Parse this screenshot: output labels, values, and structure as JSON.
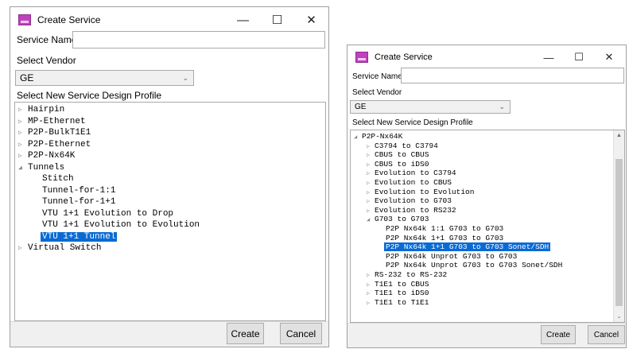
{
  "left_dialog": {
    "title": "Create Service",
    "service_name_label": "Service Name",
    "select_vendor_label": "Select Vendor",
    "vendor_value": "GE",
    "profile_label": "Select New Service Design Profile",
    "tree": [
      {
        "glyph": "▷",
        "label": "Hairpin"
      },
      {
        "glyph": "▷",
        "label": "MP-Ethernet"
      },
      {
        "glyph": "▷",
        "label": "P2P-BulkT1E1"
      },
      {
        "glyph": "▷",
        "label": "P2P-Ethernet"
      },
      {
        "glyph": "▷",
        "label": "P2P-Nx64K"
      },
      {
        "glyph": "◢",
        "label": "Tunnels"
      },
      {
        "glyph": "",
        "label": "Stitch"
      },
      {
        "glyph": "",
        "label": "Tunnel-for-1:1"
      },
      {
        "glyph": "",
        "label": "Tunnel-for-1+1"
      },
      {
        "glyph": "",
        "label": "VTU 1+1 Evolution to Drop"
      },
      {
        "glyph": "",
        "label": "VTU 1+1 Evolution to Evolution"
      },
      {
        "glyph": "",
        "label": "VTU 1+1 Tunnel"
      },
      {
        "glyph": "▷",
        "label": "Virtual Switch"
      }
    ],
    "create_label": "Create",
    "cancel_label": "Cancel"
  },
  "right_dialog": {
    "title": "Create Service",
    "service_name_label": "Service Name",
    "select_vendor_label": "Select Vendor",
    "vendor_value": "GE",
    "profile_label": "Select New Service Design Profile",
    "tree": [
      {
        "glyph": "◢",
        "label": "P2P-Nx64K"
      },
      {
        "glyph": "▷",
        "label": "C3794 to C3794"
      },
      {
        "glyph": "▷",
        "label": "CBUS to CBUS"
      },
      {
        "glyph": "▷",
        "label": "CBUS to iDS0"
      },
      {
        "glyph": "▷",
        "label": "Evolution to C3794"
      },
      {
        "glyph": "▷",
        "label": "Evolution to CBUS"
      },
      {
        "glyph": "▷",
        "label": "Evolution to Evolution"
      },
      {
        "glyph": "▷",
        "label": "Evolution to G703"
      },
      {
        "glyph": "▷",
        "label": "Evolution to RS232"
      },
      {
        "glyph": "◢",
        "label": "G703 to G703"
      },
      {
        "glyph": "",
        "label": "P2P Nx64k 1:1 G703 to G703"
      },
      {
        "glyph": "",
        "label": "P2P Nx64k 1+1 G703 to G703"
      },
      {
        "glyph": "",
        "label": "P2P Nx64k 1+1 G703 to G703 Sonet/SDH"
      },
      {
        "glyph": "",
        "label": "P2P Nx64k Unprot G703 to G703"
      },
      {
        "glyph": "",
        "label": "P2P Nx64k Unprot G703 to G703 Sonet/SDH"
      },
      {
        "glyph": "▷",
        "label": "RS-232 to RS-232"
      },
      {
        "glyph": "▷",
        "label": "T1E1 to CBUS"
      },
      {
        "glyph": "▷",
        "label": "T1E1 to iDS0"
      },
      {
        "glyph": "▷",
        "label": "T1E1 to T1E1"
      }
    ],
    "create_label": "Create",
    "cancel_label": "Cancel"
  },
  "window_controls": {
    "minimize": "—",
    "maximize": "☐",
    "close": "✕"
  },
  "icons": {
    "app": "create-service-app-icon",
    "dropdown": "chevron-down-icon",
    "expand": "triangle-right-icon",
    "collapse": "triangle-down-icon"
  },
  "colors": {
    "selection": "#0a6ad4",
    "app_icon": "#c040c0"
  }
}
